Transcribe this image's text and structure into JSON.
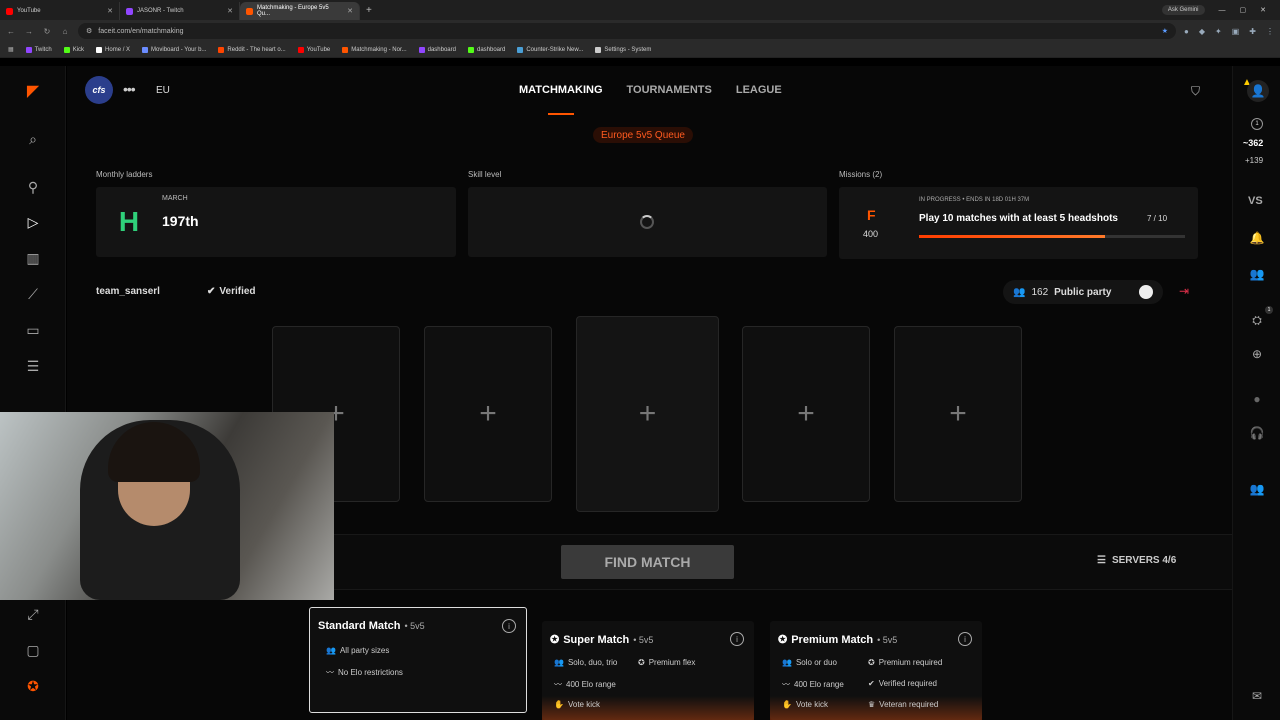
{
  "browser": {
    "tabs": [
      {
        "title": "YouTube",
        "color": "#ff0000"
      },
      {
        "title": "JASONR - Twitch",
        "color": "#9146ff"
      },
      {
        "title": "Matchmaking - Europe 5v5 Qu...",
        "color": "#ff5500"
      }
    ],
    "ask_gemini": "Ask Gemini",
    "url": "faceit.com/en/matchmaking",
    "bookmarks": [
      {
        "label": "Twitch",
        "color": "#9146ff"
      },
      {
        "label": "Kick",
        "color": "#53fc18"
      },
      {
        "label": "Home / X",
        "color": "#ffffff"
      },
      {
        "label": "Moviboard - Your b...",
        "color": "#6b8cff"
      },
      {
        "label": "Reddit - The heart o...",
        "color": "#ff4500"
      },
      {
        "label": "YouTube",
        "color": "#ff0000"
      },
      {
        "label": "Matchmaking - Nor...",
        "color": "#ff5500"
      },
      {
        "label": "dashboard",
        "color": "#9146ff"
      },
      {
        "label": "dashboard",
        "color": "#53fc18"
      },
      {
        "label": "Counter-Strike New...",
        "color": "#4a9fd6"
      },
      {
        "label": "Settings - System",
        "color": "#cccccc"
      }
    ]
  },
  "header": {
    "team_logo_text": "cfs",
    "region": "EU",
    "nav": [
      "MATCHMAKING",
      "TOURNAMENTS",
      "LEAGUE"
    ],
    "queue": "Europe 5v5 Queue"
  },
  "ladders": {
    "label": "Monthly ladders",
    "month": "MARCH",
    "rank": "197th"
  },
  "skill": {
    "label": "Skill level"
  },
  "missions": {
    "label": "Missions (2)",
    "points": "400",
    "status": "IN PROGRESS • ENDS IN 18D 01H 37M",
    "title": "Play 10 matches with at least 5 headshots",
    "count": "7 / 10",
    "progress": 0.7
  },
  "party": {
    "team_name": "team_sanserl",
    "verified": "Verified",
    "members_count": "162",
    "public_label": "Public party",
    "slot_symbol": "+"
  },
  "find": {
    "button": "FIND MATCH",
    "servers": "SERVERS 4/6"
  },
  "modes": [
    {
      "title": "Standard Match",
      "sub": "• 5v5",
      "features": [
        "All party sizes",
        "No Elo restrictions"
      ]
    },
    {
      "title": "Super Match",
      "sub": "• 5v5",
      "features": [
        "Solo, duo, trio",
        "Premium flex",
        "400 Elo range",
        "Vote kick"
      ]
    },
    {
      "title": "Premium Match",
      "sub": "• 5v5",
      "features": [
        "Solo or duo",
        "Premium required",
        "400 Elo range",
        "Verified required",
        "Vote kick",
        "Veteran required"
      ]
    }
  ],
  "right_rail": {
    "level": "1",
    "elo": "~362",
    "delta": "+139",
    "vs": "VS",
    "badge": "1"
  }
}
